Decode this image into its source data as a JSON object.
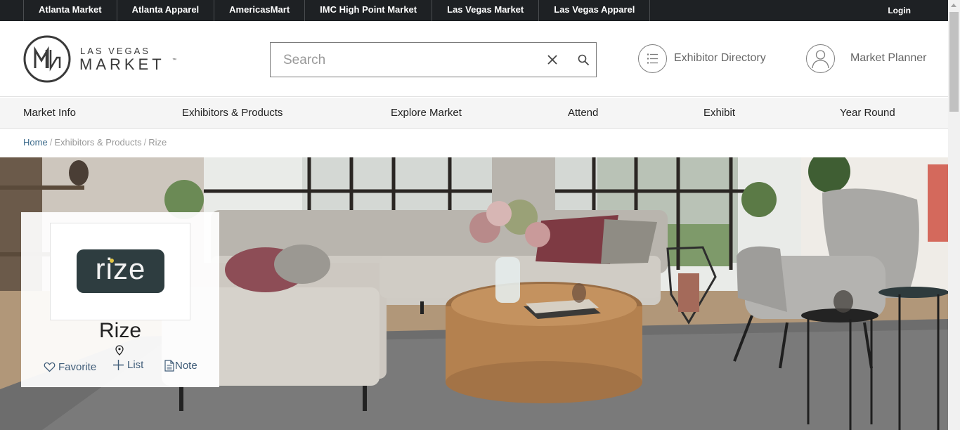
{
  "topbar": {
    "links": [
      "Atlanta Market",
      "Atlanta Apparel",
      "AmericasMart",
      "IMC High Point Market",
      "Las Vegas Market",
      "Las Vegas Apparel"
    ],
    "login": "Login"
  },
  "header": {
    "logo_top": "LAS VEGAS",
    "logo_bottom": "MARKET",
    "logo_tm": "™",
    "search_placeholder": "Search",
    "exhibitor_directory": "Exhibitor Directory",
    "market_planner": "Market Planner"
  },
  "nav": {
    "items": [
      "Market Info",
      "Exhibitors & Products",
      "Explore Market",
      "Attend",
      "Exhibit",
      "Year Round"
    ]
  },
  "breadcrumb": {
    "home": "Home",
    "section": "Exhibitors & Products",
    "current": "Rize",
    "separator": "/"
  },
  "exhibitor": {
    "logo_text": "rize",
    "name": "Rize",
    "actions": {
      "favorite": "Favorite",
      "list": "List",
      "note": "Note"
    }
  },
  "colors": {
    "topbar": "#1e2124",
    "link_blue": "#3b6a8b",
    "logo_bg": "#2e3d40"
  }
}
